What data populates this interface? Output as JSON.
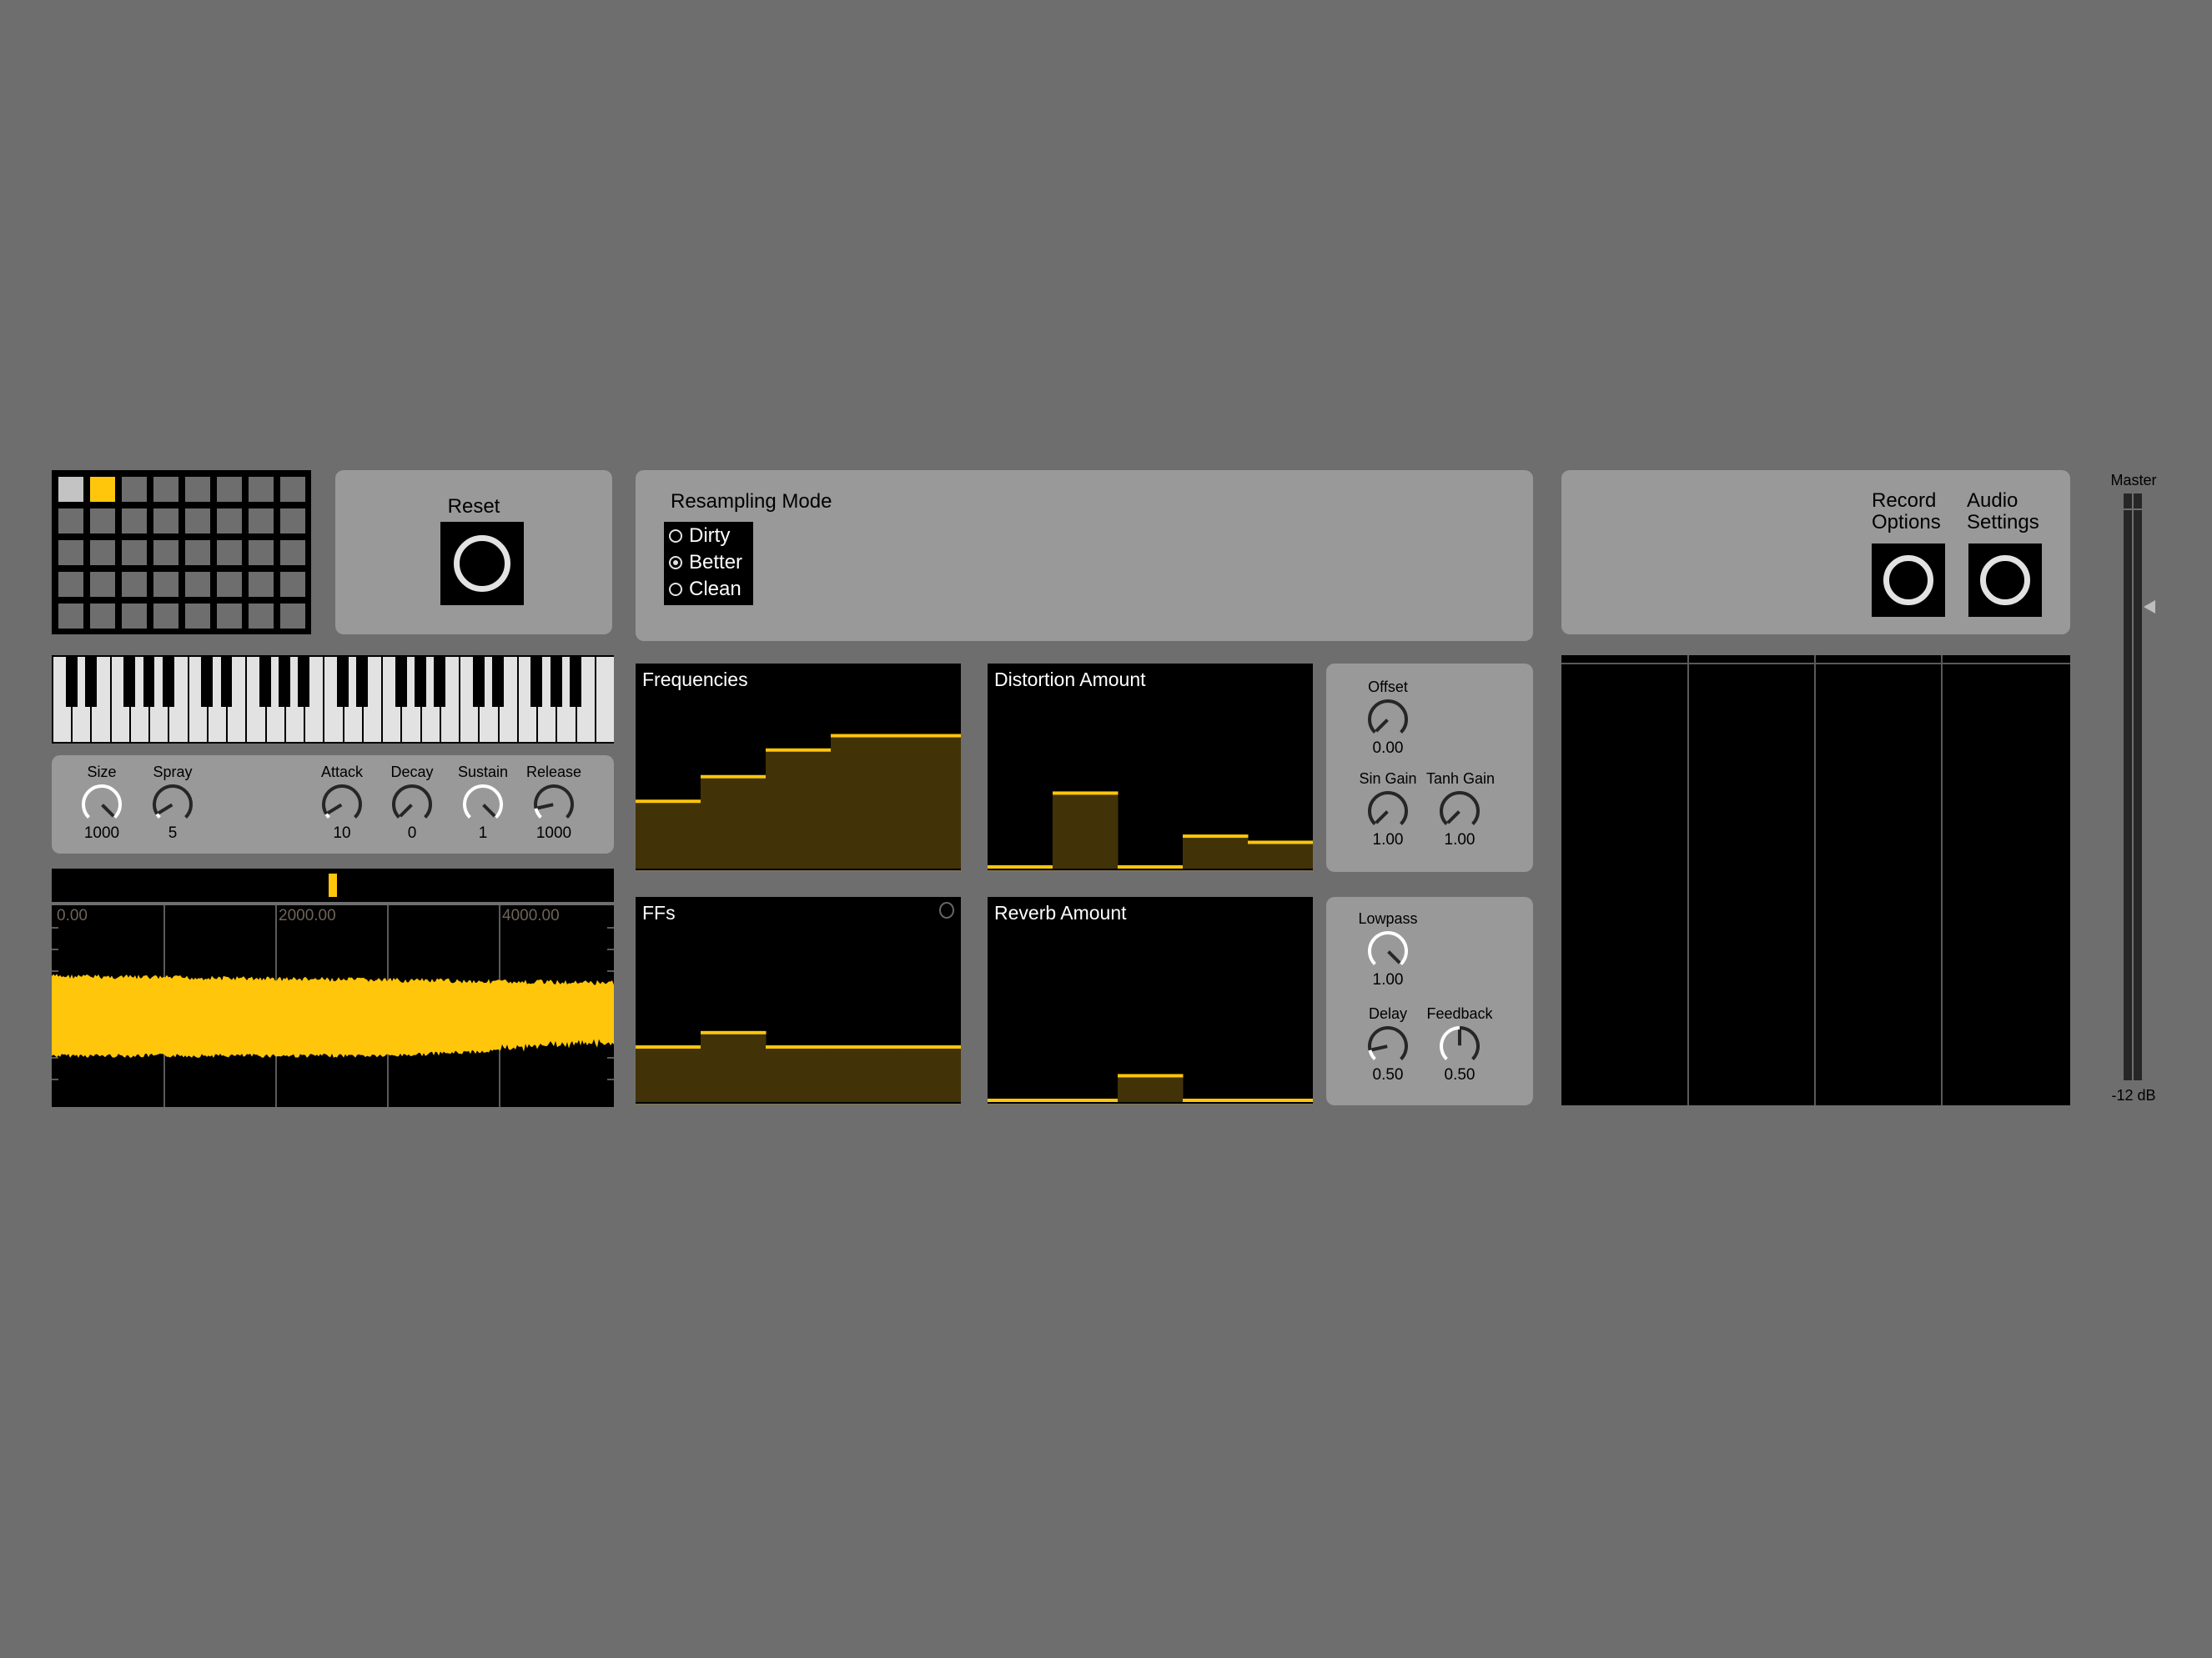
{
  "matrix": {
    "rows": 5,
    "cols": 8,
    "active_cells": [
      {
        "row": 0,
        "col": 0,
        "state": "selected-gray"
      },
      {
        "row": 0,
        "col": 1,
        "state": "on"
      }
    ],
    "colors": {
      "on": "#ffc60b",
      "selected": "#c3c3c3",
      "off": "#6e6e6e"
    }
  },
  "reset": {
    "label": "Reset"
  },
  "resampling": {
    "title": "Resampling Mode",
    "options": [
      "Dirty",
      "Better",
      "Clean"
    ],
    "selected": "Better"
  },
  "record_options": {
    "label_line1": "Record",
    "label_line2": "Options"
  },
  "audio_settings": {
    "label_line1": "Audio",
    "label_line2": "Settings"
  },
  "grain_knobs": [
    {
      "label": "Size",
      "value": "1000",
      "position": 1.0
    },
    {
      "label": "Spray",
      "value": "5",
      "position": 0.05
    },
    {
      "label": "Attack",
      "value": "10",
      "position": 0.05
    },
    {
      "label": "Decay",
      "value": "0",
      "position": 0.0
    },
    {
      "label": "Sustain",
      "value": "1",
      "position": 1.0
    },
    {
      "label": "Release",
      "value": "1000",
      "position": 0.12
    }
  ],
  "waveform": {
    "ticks": [
      "0.00",
      "2000.00",
      "4000.00"
    ],
    "playhead_fraction": 0.5
  },
  "sliders": {
    "frequencies": {
      "title": "Frequencies",
      "values": [
        0.32,
        0.44,
        0.57,
        0.64,
        0.64
      ]
    },
    "distortion": {
      "title": "Distortion Amount",
      "values": [
        0.0,
        0.36,
        0.0,
        0.15,
        0.12
      ]
    },
    "ffs": {
      "title": "FFs",
      "values": [
        0.26,
        0.33,
        0.26,
        0.26,
        0.26
      ]
    },
    "reverb": {
      "title": "Reverb Amount",
      "values": [
        0.0,
        0.0,
        0.12,
        0.0,
        0.0
      ]
    }
  },
  "distortion_knobs": [
    {
      "label": "Offset",
      "value": "0.00",
      "position": 0.0
    },
    {
      "label": "Sin Gain",
      "value": "1.00",
      "position": 0.0
    },
    {
      "label": "Tanh Gain",
      "value": "1.00",
      "position": 0.0
    }
  ],
  "reverb_knobs": [
    {
      "label": "Lowpass",
      "value": "1.00",
      "position": 1.0
    },
    {
      "label": "Delay",
      "value": "0.50",
      "position": 0.12
    },
    {
      "label": "Feedback",
      "value": "0.50",
      "position": 0.5
    }
  ],
  "master": {
    "label": "Master",
    "level_label": "-12 dB"
  },
  "colors": {
    "accent": "#ffc60b",
    "fill": "#413307",
    "panel": "#999999",
    "background": "#6e6e6e"
  }
}
